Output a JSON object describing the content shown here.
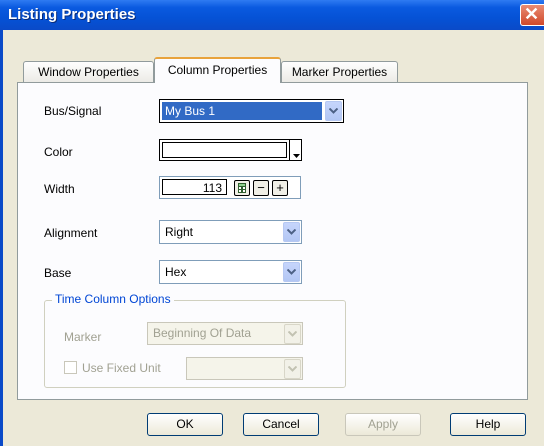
{
  "window": {
    "title": "Listing Properties",
    "close_glyph": "✕"
  },
  "tabs": [
    {
      "label": "Window Properties",
      "active": false
    },
    {
      "label": "Column Properties",
      "active": true
    },
    {
      "label": "Marker Properties",
      "active": false
    }
  ],
  "form": {
    "bus_signal": {
      "label": "Bus/Signal",
      "value": "My Bus 1"
    },
    "color": {
      "label": "Color",
      "value": "#ffffff"
    },
    "width": {
      "label": "Width",
      "value": "113",
      "minus": "−",
      "plus": "+"
    },
    "alignment": {
      "label": "Alignment",
      "value": "Right"
    },
    "base": {
      "label": "Base",
      "value": "Hex"
    }
  },
  "time_column": {
    "title": "Time Column Options",
    "marker_label": "Marker",
    "marker_value": "Beginning Of Data",
    "use_fixed_unit_label": "Use Fixed Unit",
    "use_fixed_unit_checked": false,
    "fixed_unit_value": ""
  },
  "buttons": {
    "ok": "OK",
    "cancel": "Cancel",
    "apply": "Apply",
    "help": "Help"
  },
  "icons": {
    "dropdown": "chevron-down-icon",
    "calculator": "calculator-icon",
    "close": "close-icon"
  }
}
